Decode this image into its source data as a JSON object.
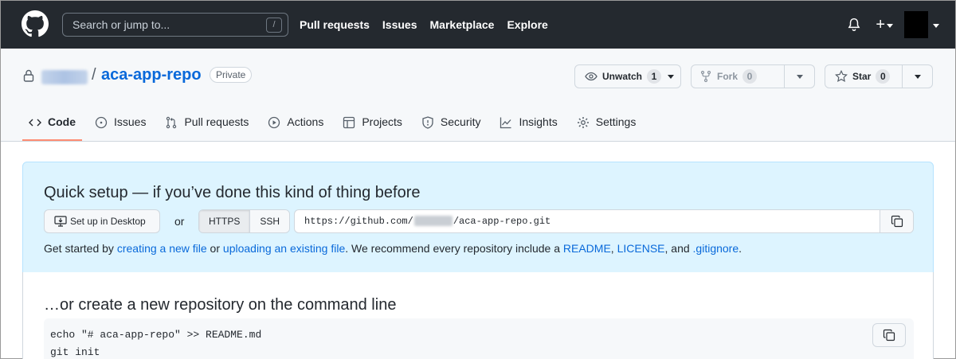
{
  "header": {
    "search_placeholder": "Search or jump to...",
    "search_key": "/",
    "nav": [
      "Pull requests",
      "Issues",
      "Marketplace",
      "Explore"
    ],
    "plus": "+"
  },
  "repo": {
    "separator": "/",
    "name": "aca-app-repo",
    "visibility": "Private",
    "unwatch_label": "Unwatch",
    "unwatch_count": "1",
    "fork_label": "Fork",
    "fork_count": "0",
    "star_label": "Star",
    "star_count": "0"
  },
  "tabs": [
    {
      "label": "Code",
      "icon": "code-icon",
      "selected": true
    },
    {
      "label": "Issues",
      "icon": "issue-opened-icon"
    },
    {
      "label": "Pull requests",
      "icon": "git-pull-request-icon"
    },
    {
      "label": "Actions",
      "icon": "play-icon"
    },
    {
      "label": "Projects",
      "icon": "table-icon"
    },
    {
      "label": "Security",
      "icon": "shield-icon"
    },
    {
      "label": "Insights",
      "icon": "graph-icon"
    },
    {
      "label": "Settings",
      "icon": "gear-icon"
    }
  ],
  "quick_setup": {
    "title": "Quick setup — if you’ve done this kind of thing before",
    "desktop_button": "Set up in Desktop",
    "or": "or",
    "protocols": [
      "HTTPS",
      "SSH"
    ],
    "selected_protocol": "HTTPS",
    "url_prefix": "https://github.com/",
    "url_suffix": "/aca-app-repo.git",
    "text_1": "Get started by ",
    "link_new_file": "creating a new file",
    "text_2": " or ",
    "link_upload": "uploading an existing file",
    "text_3": ". We recommend every repository include a ",
    "link_readme": "README",
    "text_4": ", ",
    "link_license": "LICENSE",
    "text_5": ", and ",
    "link_gitignore": ".gitignore",
    "text_6": "."
  },
  "command_line": {
    "title": "…or create a new repository on the command line",
    "lines": [
      "echo \"# aca-app-repo\" >> README.md",
      "git init"
    ]
  },
  "colors": {
    "header_bg": "#24292f",
    "link": "#0969da",
    "quick_setup_bg": "#ddf4ff",
    "selected_tab_underline": "#fd8c73"
  }
}
